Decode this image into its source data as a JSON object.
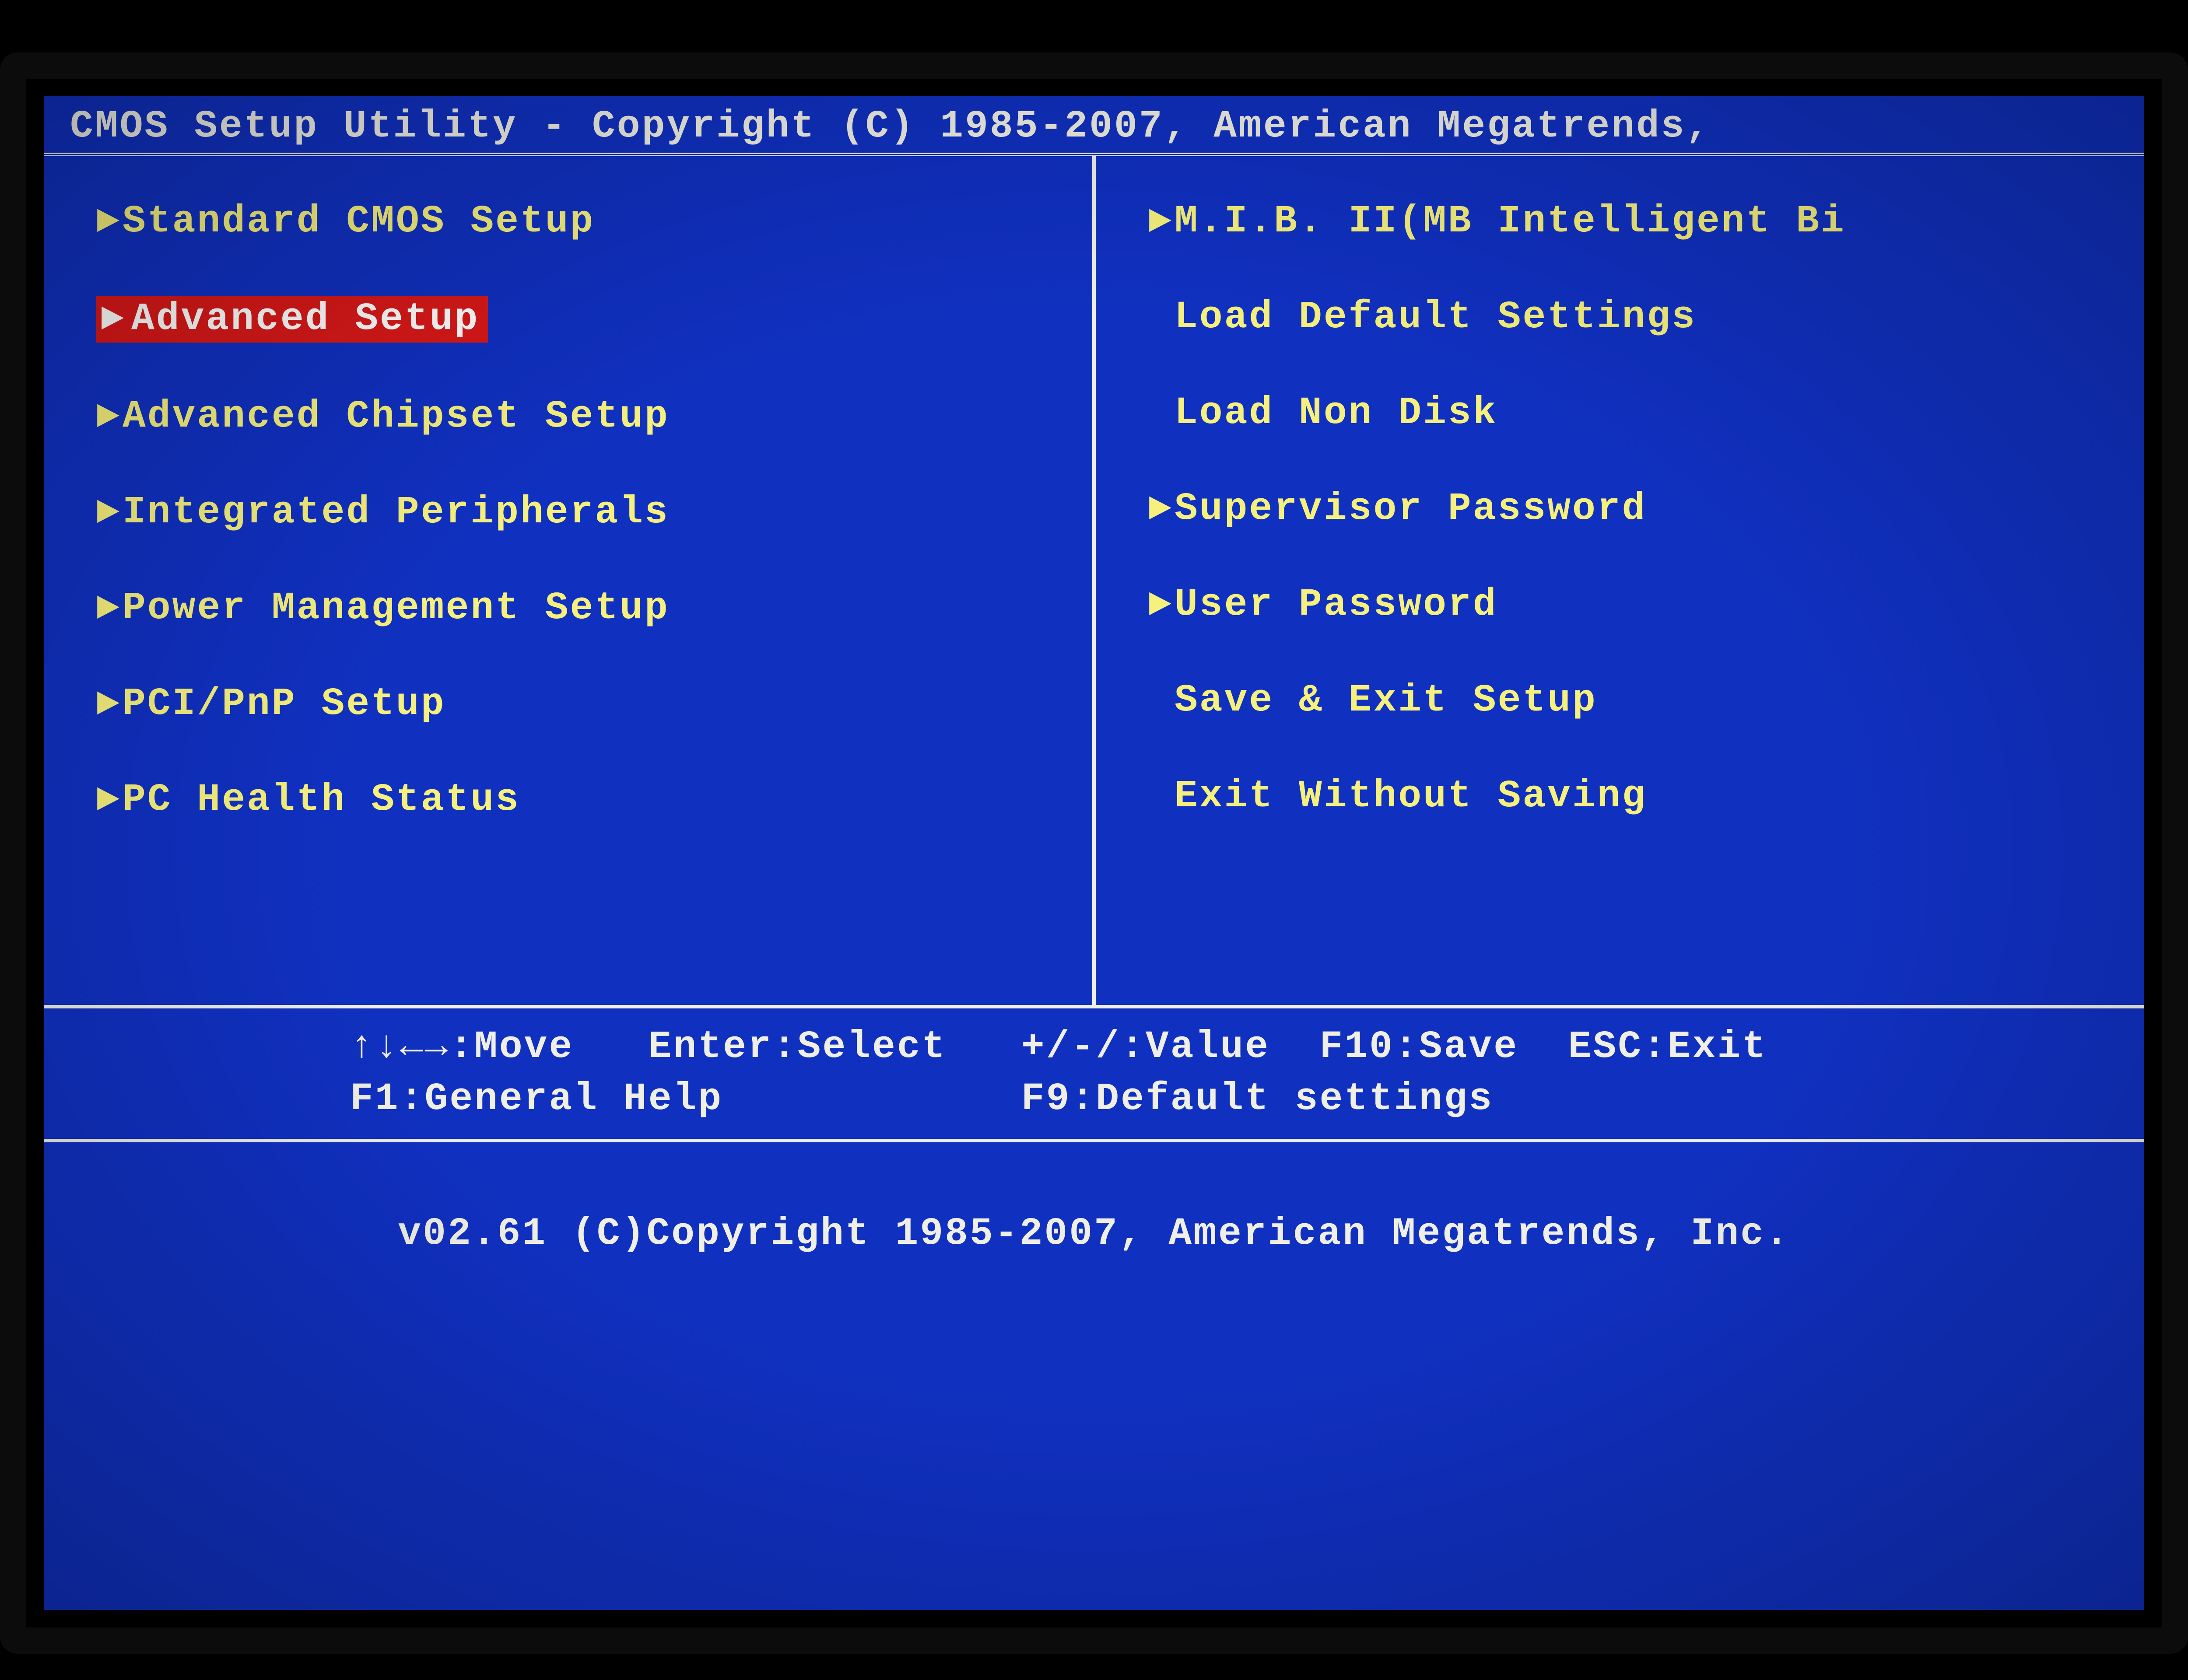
{
  "header": {
    "title": "CMOS Setup Utility - Copyright (C) 1985-2007, American Megatrends,"
  },
  "menu": {
    "left": [
      {
        "label": "Standard CMOS Setup",
        "arrow": true,
        "selected": false
      },
      {
        "label": "Advanced Setup",
        "arrow": true,
        "selected": true
      },
      {
        "label": "Advanced Chipset Setup",
        "arrow": true,
        "selected": false
      },
      {
        "label": "Integrated Peripherals",
        "arrow": true,
        "selected": false
      },
      {
        "label": "Power Management Setup",
        "arrow": true,
        "selected": false
      },
      {
        "label": "PCI/PnP Setup",
        "arrow": true,
        "selected": false
      },
      {
        "label": "PC Health Status",
        "arrow": true,
        "selected": false
      }
    ],
    "right": [
      {
        "label": "M.I.B. II(MB Intelligent Bi",
        "arrow": true,
        "selected": false
      },
      {
        "label": "Load Default Settings",
        "arrow": false,
        "selected": false
      },
      {
        "label": "Load Non Disk",
        "arrow": false,
        "selected": false
      },
      {
        "label": "Supervisor Password",
        "arrow": true,
        "selected": false
      },
      {
        "label": "User Password",
        "arrow": true,
        "selected": false
      },
      {
        "label": "Save & Exit Setup",
        "arrow": false,
        "selected": false
      },
      {
        "label": "Exit Without Saving",
        "arrow": false,
        "selected": false
      }
    ]
  },
  "hints": {
    "line1": "↑↓←→:Move   Enter:Select   +/-/:Value  F10:Save  ESC:Exit",
    "line2": "F1:General Help            F9:Default settings"
  },
  "footer": {
    "text": "v02.61 (C)Copyright 1985-2007, American Megatrends, Inc."
  }
}
